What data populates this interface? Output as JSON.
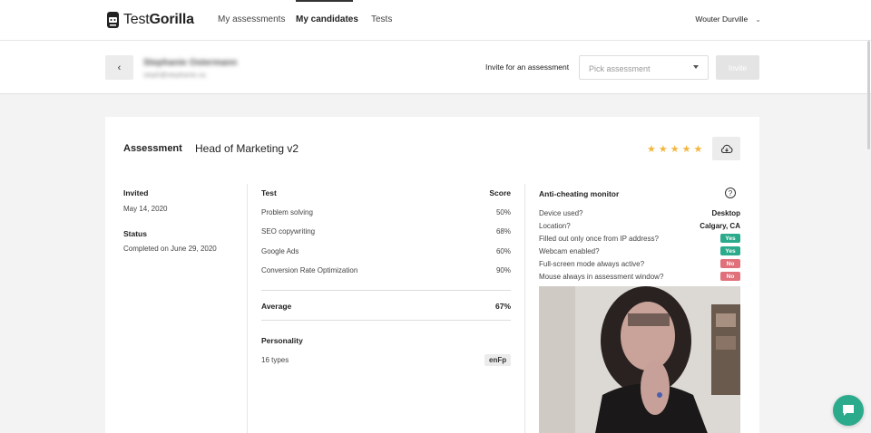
{
  "nav": {
    "logo_light": "Test",
    "logo_bold": "Gorilla",
    "links": [
      "My assessments",
      "My candidates",
      "Tests"
    ],
    "user": "Wouter Durville"
  },
  "candidate": {
    "name": "Stephanie Ostermann",
    "email": "steph@stephanie.ca",
    "invite_label": "Invite for an assessment",
    "pick_placeholder": "Pick assessment",
    "invite_button": "Invite"
  },
  "assessment": {
    "label": "Assessment",
    "name": "Head of Marketing v2",
    "rating": 5,
    "invited_label": "Invited",
    "invited_date": "May 14, 2020",
    "status_label": "Status",
    "status_value": "Completed on June 29, 2020"
  },
  "tests": {
    "header_test": "Test",
    "header_score": "Score",
    "rows": [
      {
        "name": "Problem solving",
        "score": "50%"
      },
      {
        "name": "SEO copywriting",
        "score": "68%"
      },
      {
        "name": "Google Ads",
        "score": "60%"
      },
      {
        "name": "Conversion Rate Optimization",
        "score": "90%"
      }
    ],
    "average_label": "Average",
    "average_value": "67%",
    "personality_label": "Personality",
    "personality_test": "16 types",
    "personality_value": "enFp"
  },
  "anti_cheating": {
    "title": "Anti-cheating monitor",
    "rows": [
      {
        "q": "Device used?",
        "a": "Desktop",
        "kind": "text"
      },
      {
        "q": "Location?",
        "a": "Calgary, CA",
        "kind": "text"
      },
      {
        "q": "Filled out only once from IP address?",
        "a": "Yes",
        "kind": "yes"
      },
      {
        "q": "Webcam enabled?",
        "a": "Yes",
        "kind": "yes"
      },
      {
        "q": "Full-screen mode always active?",
        "a": "No",
        "kind": "no"
      },
      {
        "q": "Mouse always in assessment window?",
        "a": "No",
        "kind": "no"
      }
    ]
  },
  "colors": {
    "accent": "#2bab8c",
    "star": "#f4b63f",
    "no": "#e0707a"
  }
}
